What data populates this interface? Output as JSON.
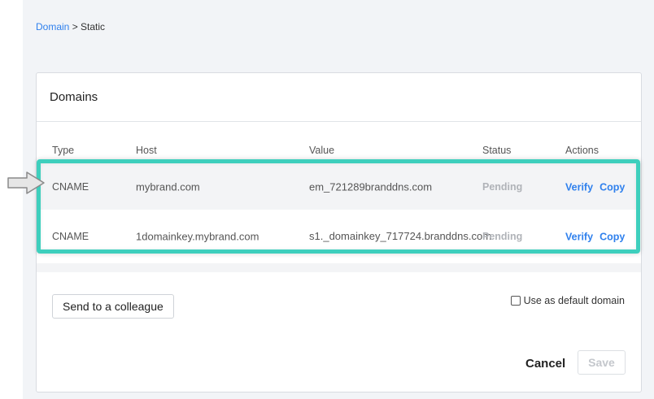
{
  "breadcrumb": {
    "link": "Domain",
    "separator": " > ",
    "current": "Static"
  },
  "card": {
    "title": "Domains"
  },
  "table": {
    "headers": {
      "type": "Type",
      "host": "Host",
      "value": "Value",
      "status": "Status",
      "actions": "Actions"
    },
    "rows": [
      {
        "type": "CNAME",
        "host": "mybrand.com",
        "value": "em_721289branddns.com",
        "status": "Pending",
        "verify": "Verify",
        "copy": "Copy"
      },
      {
        "type": "CNAME",
        "host": "1domainkey.mybrand.com",
        "value": "s1._domainkey_717724.branddns.com",
        "status": "Pending",
        "verify": "Verify",
        "copy": "Copy"
      }
    ]
  },
  "buttons": {
    "send": "Send to a colleague",
    "cancel": "Cancel",
    "save": "Save"
  },
  "default_domain": {
    "label": "Use as default domain",
    "checked": false
  },
  "colors": {
    "accent": "#2f80ed",
    "highlight": "#3ecfbd",
    "pending": "#b0b3b8"
  },
  "icons": {
    "pointer": "pointer-arrow-icon"
  }
}
